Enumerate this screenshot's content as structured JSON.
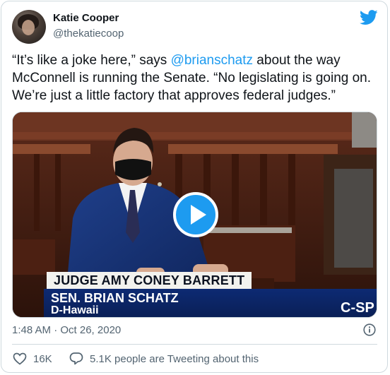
{
  "author": {
    "display_name": "Katie Cooper",
    "handle": "@thekatiecoop"
  },
  "tweet": {
    "text_before_mention": "“It’s like a joke here,” says ",
    "mention": "@brianschatz",
    "text_after_mention": " about the way McConnell is running the Senate. “No legislating is going on. We’re just a little factory that approves federal judges.”"
  },
  "media": {
    "chyron_top": "JUDGE AMY CONEY BARRETT",
    "chyron_name": "SEN. BRIAN SCHATZ",
    "chyron_state": "D-Hawaii",
    "network_logo": "C-SP"
  },
  "meta": {
    "timestamp": "1:48 AM · Oct 26, 2020"
  },
  "actions": {
    "like_count": "16K",
    "conversation_text": "5.1K people are Tweeting about this"
  },
  "colors": {
    "accent": "#1d9bf0",
    "text_primary": "#0f1419",
    "text_secondary": "#536471",
    "border": "#cfd9de"
  },
  "icons": [
    "twitter-bird-icon",
    "play-icon",
    "info-icon",
    "heart-icon",
    "speech-bubble-icon"
  ]
}
